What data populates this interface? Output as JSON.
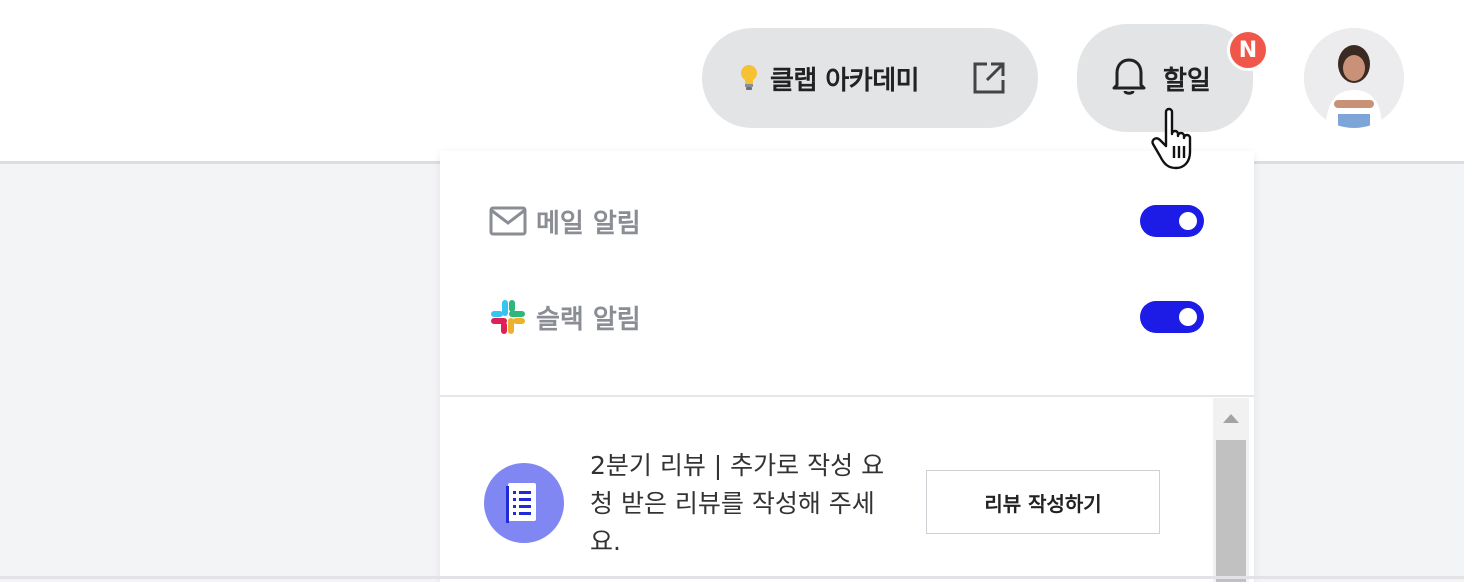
{
  "header": {
    "academy_label": "클랩 아카데미",
    "academy_icon": "lightbulb-icon",
    "academy_link_icon": "external-link-icon",
    "todo_label": "할일",
    "todo_icon": "bell-icon",
    "todo_badge": "N",
    "avatar_icon": "user-avatar"
  },
  "notifications": {
    "email": {
      "label": "메일 알림",
      "icon": "mail-icon",
      "enabled": true
    },
    "slack": {
      "label": "슬랙 알림",
      "icon": "slack-icon",
      "enabled": true
    }
  },
  "tasks": [
    {
      "icon": "document-icon",
      "text": "2분기 리뷰 | 추가로 작성 요청 받은 리뷰를 작성해 주세요.",
      "button_label": "리뷰 작성하기"
    }
  ],
  "colors": {
    "toggle_on": "#1c1ce6",
    "badge": "#f0574a",
    "task_icon_bg": "#8087f3",
    "pill_bg": "#e2e4e6"
  }
}
